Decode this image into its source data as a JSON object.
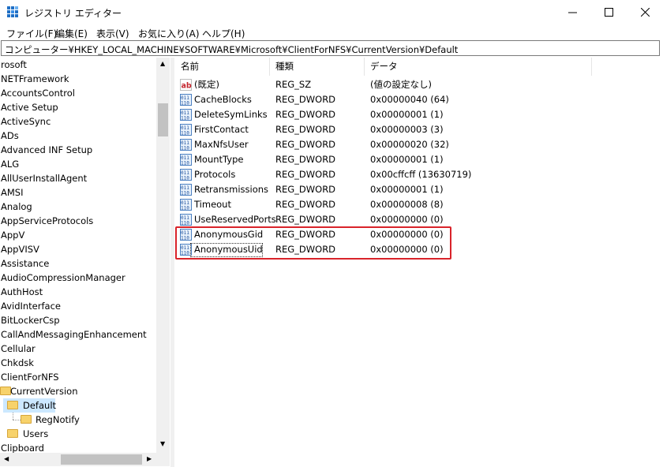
{
  "window": {
    "title": "レジストリ エディター"
  },
  "menu": [
    "ファイル(F)",
    "編集(E)",
    "表示(V)",
    "お気に入り(A)",
    "ヘルプ(H)"
  ],
  "address": "コンピューター¥HKEY_LOCAL_MACHINE¥SOFTWARE¥Microsoft¥ClientForNFS¥CurrentVersion¥Default",
  "tree": [
    {
      "label": "rosoft"
    },
    {
      "label": "NETFramework"
    },
    {
      "label": "AccountsControl"
    },
    {
      "label": "Active Setup"
    },
    {
      "label": "ActiveSync"
    },
    {
      "label": "ADs"
    },
    {
      "label": "Advanced INF Setup"
    },
    {
      "label": "ALG"
    },
    {
      "label": "AllUserInstallAgent"
    },
    {
      "label": "AMSI"
    },
    {
      "label": "Analog"
    },
    {
      "label": "AppServiceProtocols"
    },
    {
      "label": "AppV"
    },
    {
      "label": "AppVISV"
    },
    {
      "label": "Assistance"
    },
    {
      "label": "AudioCompressionManager"
    },
    {
      "label": "AuthHost"
    },
    {
      "label": "AvidInterface"
    },
    {
      "label": "BitLockerCsp"
    },
    {
      "label": "CallAndMessagingEnhancement"
    },
    {
      "label": "Cellular"
    },
    {
      "label": "Chkdsk"
    },
    {
      "label": "ClientForNFS"
    },
    {
      "label": "CurrentVersion"
    },
    {
      "label": "Default"
    },
    {
      "label": "RegNotify"
    },
    {
      "label": "Users"
    },
    {
      "label": "Clipboard"
    }
  ],
  "columns": [
    "名前",
    "種類",
    "データ"
  ],
  "values": [
    {
      "name": "(既定)",
      "type": "REG_SZ",
      "data": "(値の設定なし)",
      "icon": "string-value-icon"
    },
    {
      "name": "CacheBlocks",
      "type": "REG_DWORD",
      "data": "0x00000040 (64)",
      "icon": "binary-value-icon"
    },
    {
      "name": "DeleteSymLinks",
      "type": "REG_DWORD",
      "data": "0x00000001 (1)",
      "icon": "binary-value-icon"
    },
    {
      "name": "FirstContact",
      "type": "REG_DWORD",
      "data": "0x00000003 (3)",
      "icon": "binary-value-icon"
    },
    {
      "name": "MaxNfsUser",
      "type": "REG_DWORD",
      "data": "0x00000020 (32)",
      "icon": "binary-value-icon"
    },
    {
      "name": "MountType",
      "type": "REG_DWORD",
      "data": "0x00000001 (1)",
      "icon": "binary-value-icon"
    },
    {
      "name": "Protocols",
      "type": "REG_DWORD",
      "data": "0x00cffcff (13630719)",
      "icon": "binary-value-icon"
    },
    {
      "name": "Retransmissions",
      "type": "REG_DWORD",
      "data": "0x00000001 (1)",
      "icon": "binary-value-icon"
    },
    {
      "name": "Timeout",
      "type": "REG_DWORD",
      "data": "0x00000008 (8)",
      "icon": "binary-value-icon"
    },
    {
      "name": "UseReservedPorts",
      "type": "REG_DWORD",
      "data": "0x00000000 (0)",
      "icon": "binary-value-icon"
    },
    {
      "name": "AnonymousGid",
      "type": "REG_DWORD",
      "data": "0x00000000 (0)",
      "icon": "binary-value-icon"
    },
    {
      "name": "AnonymousUid",
      "type": "REG_DWORD",
      "data": "0x00000000 (0)",
      "icon": "binary-value-icon"
    }
  ],
  "colors": {
    "highlight_border": "#d9232a",
    "selected_item_bg": "#cce8ff"
  }
}
